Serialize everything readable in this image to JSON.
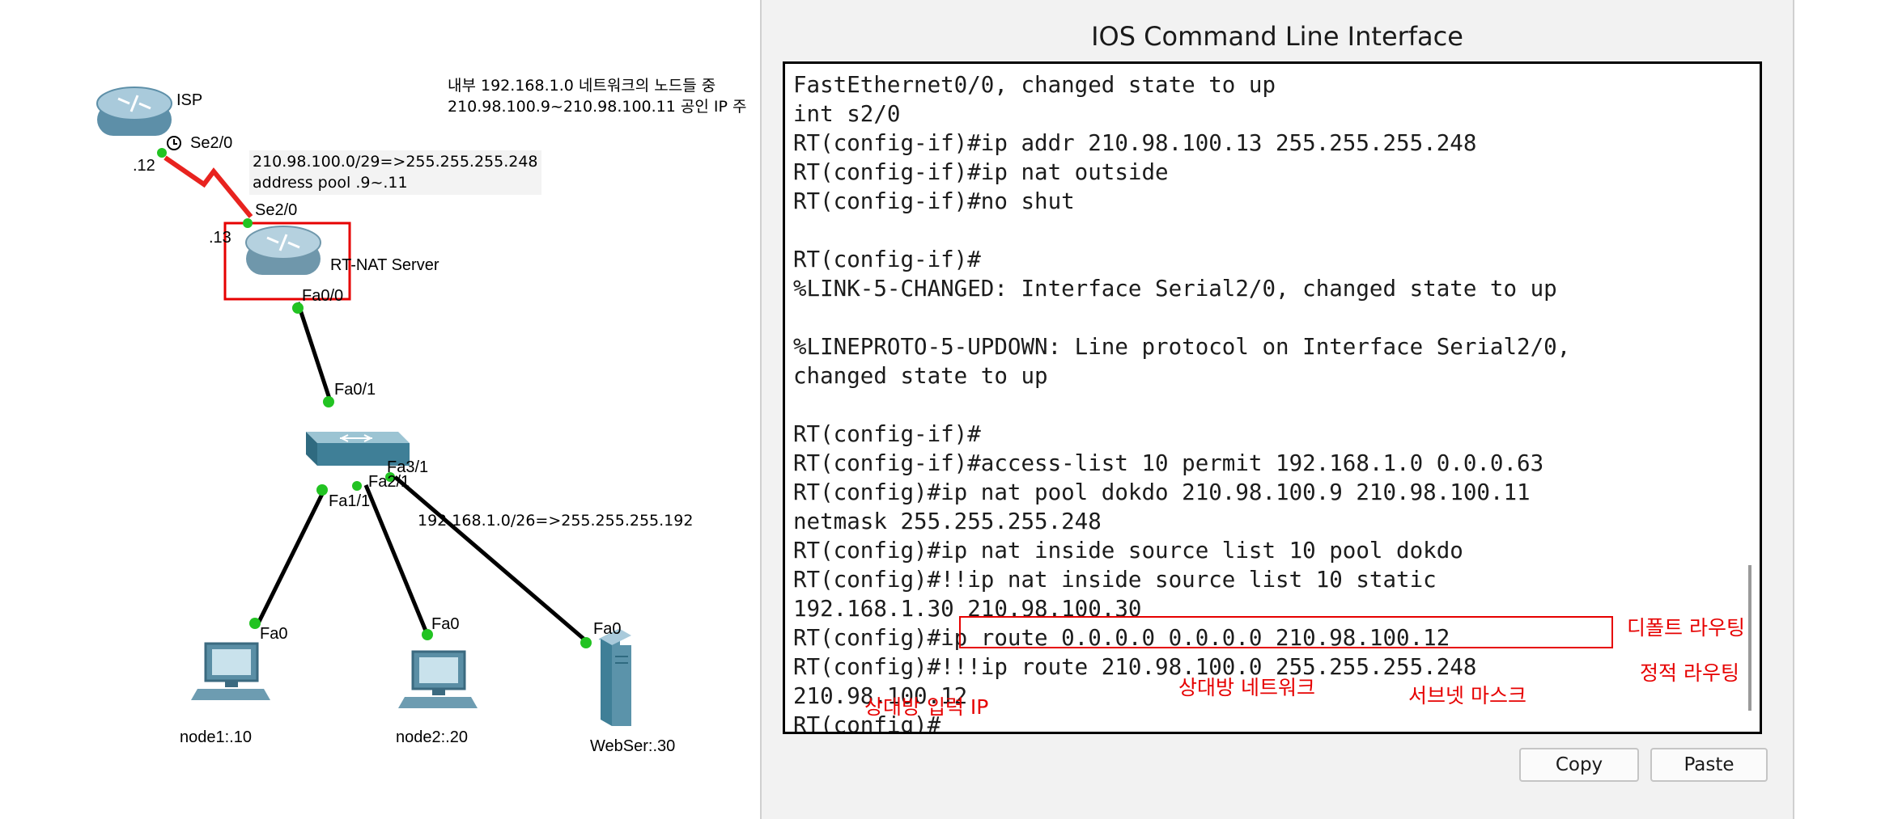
{
  "topology": {
    "notes": {
      "top_line1": "내부 192.168.1.0 네트워크의 노드들 중",
      "top_line2": "210.98.100.9~210.98.100.11 공인 IP 주",
      "wan_line1": "210.98.100.0/29=>255.255.255.248",
      "wan_line2": "address pool .9~.11",
      "lan": "192.168.1.0/26=>255.255.255.192"
    },
    "devices": {
      "isp": "ISP",
      "rt_nat": "RT-NAT Server",
      "node1": "node1:.10",
      "node2": "node2:.20",
      "webser": "WebSer:.30"
    },
    "ports": {
      "isp_se": "Se2/0",
      "isp_addr": ".12",
      "rt_se": "Se2/0",
      "rt_addr": ".13",
      "rt_fa": "Fa0/0",
      "sw_fa01": "Fa0/1",
      "sw_fa31": "Fa3/1",
      "sw_fa21": "Fa2/1",
      "sw_fa11": "Fa1/1",
      "node1_fa": "Fa0",
      "node2_fa": "Fa0",
      "web_fa": "Fa0"
    },
    "colors": {
      "serial_link": "#e8231f",
      "ethernet_link": "#000000",
      "port_up": "#22c322",
      "highlight": "#e60000"
    }
  },
  "cli": {
    "title": "IOS Command Line Interface",
    "lines": [
      "FastEthernet0/0, changed state to up",
      "int s2/0",
      "RT(config-if)#ip addr 210.98.100.13 255.255.255.248",
      "RT(config-if)#ip nat outside",
      "RT(config-if)#no shut",
      "",
      "RT(config-if)#",
      "%LINK-5-CHANGED: Interface Serial2/0, changed state to up",
      "",
      "%LINEPROTO-5-UPDOWN: Line protocol on Interface Serial2/0,",
      "changed state to up",
      "",
      "RT(config-if)#",
      "RT(config-if)#access-list 10 permit 192.168.1.0 0.0.0.63",
      "RT(config)#ip nat pool dokdo 210.98.100.9 210.98.100.11",
      "netmask 255.255.255.248",
      "RT(config)#ip nat inside source list 10 pool dokdo",
      "RT(config)#!!ip nat inside source list 10 static",
      "192.168.1.30 210.98.100.30",
      "RT(config)#ip route 0.0.0.0 0.0.0.0 210.98.100.12",
      "RT(config)#!!!ip route 210.98.100.0 255.255.255.248",
      "210.98.100.12",
      "RT(config)#"
    ],
    "buttons": {
      "copy": "Copy",
      "paste": "Paste"
    }
  },
  "annotations": {
    "default_routing": "디폴트 라우팅",
    "static_routing": "정적 라우팅",
    "peer_network": "상대방 네트워크",
    "subnet_mask": "서브넷 마스크",
    "peer_input_ip": "상대방 입력 IP"
  }
}
